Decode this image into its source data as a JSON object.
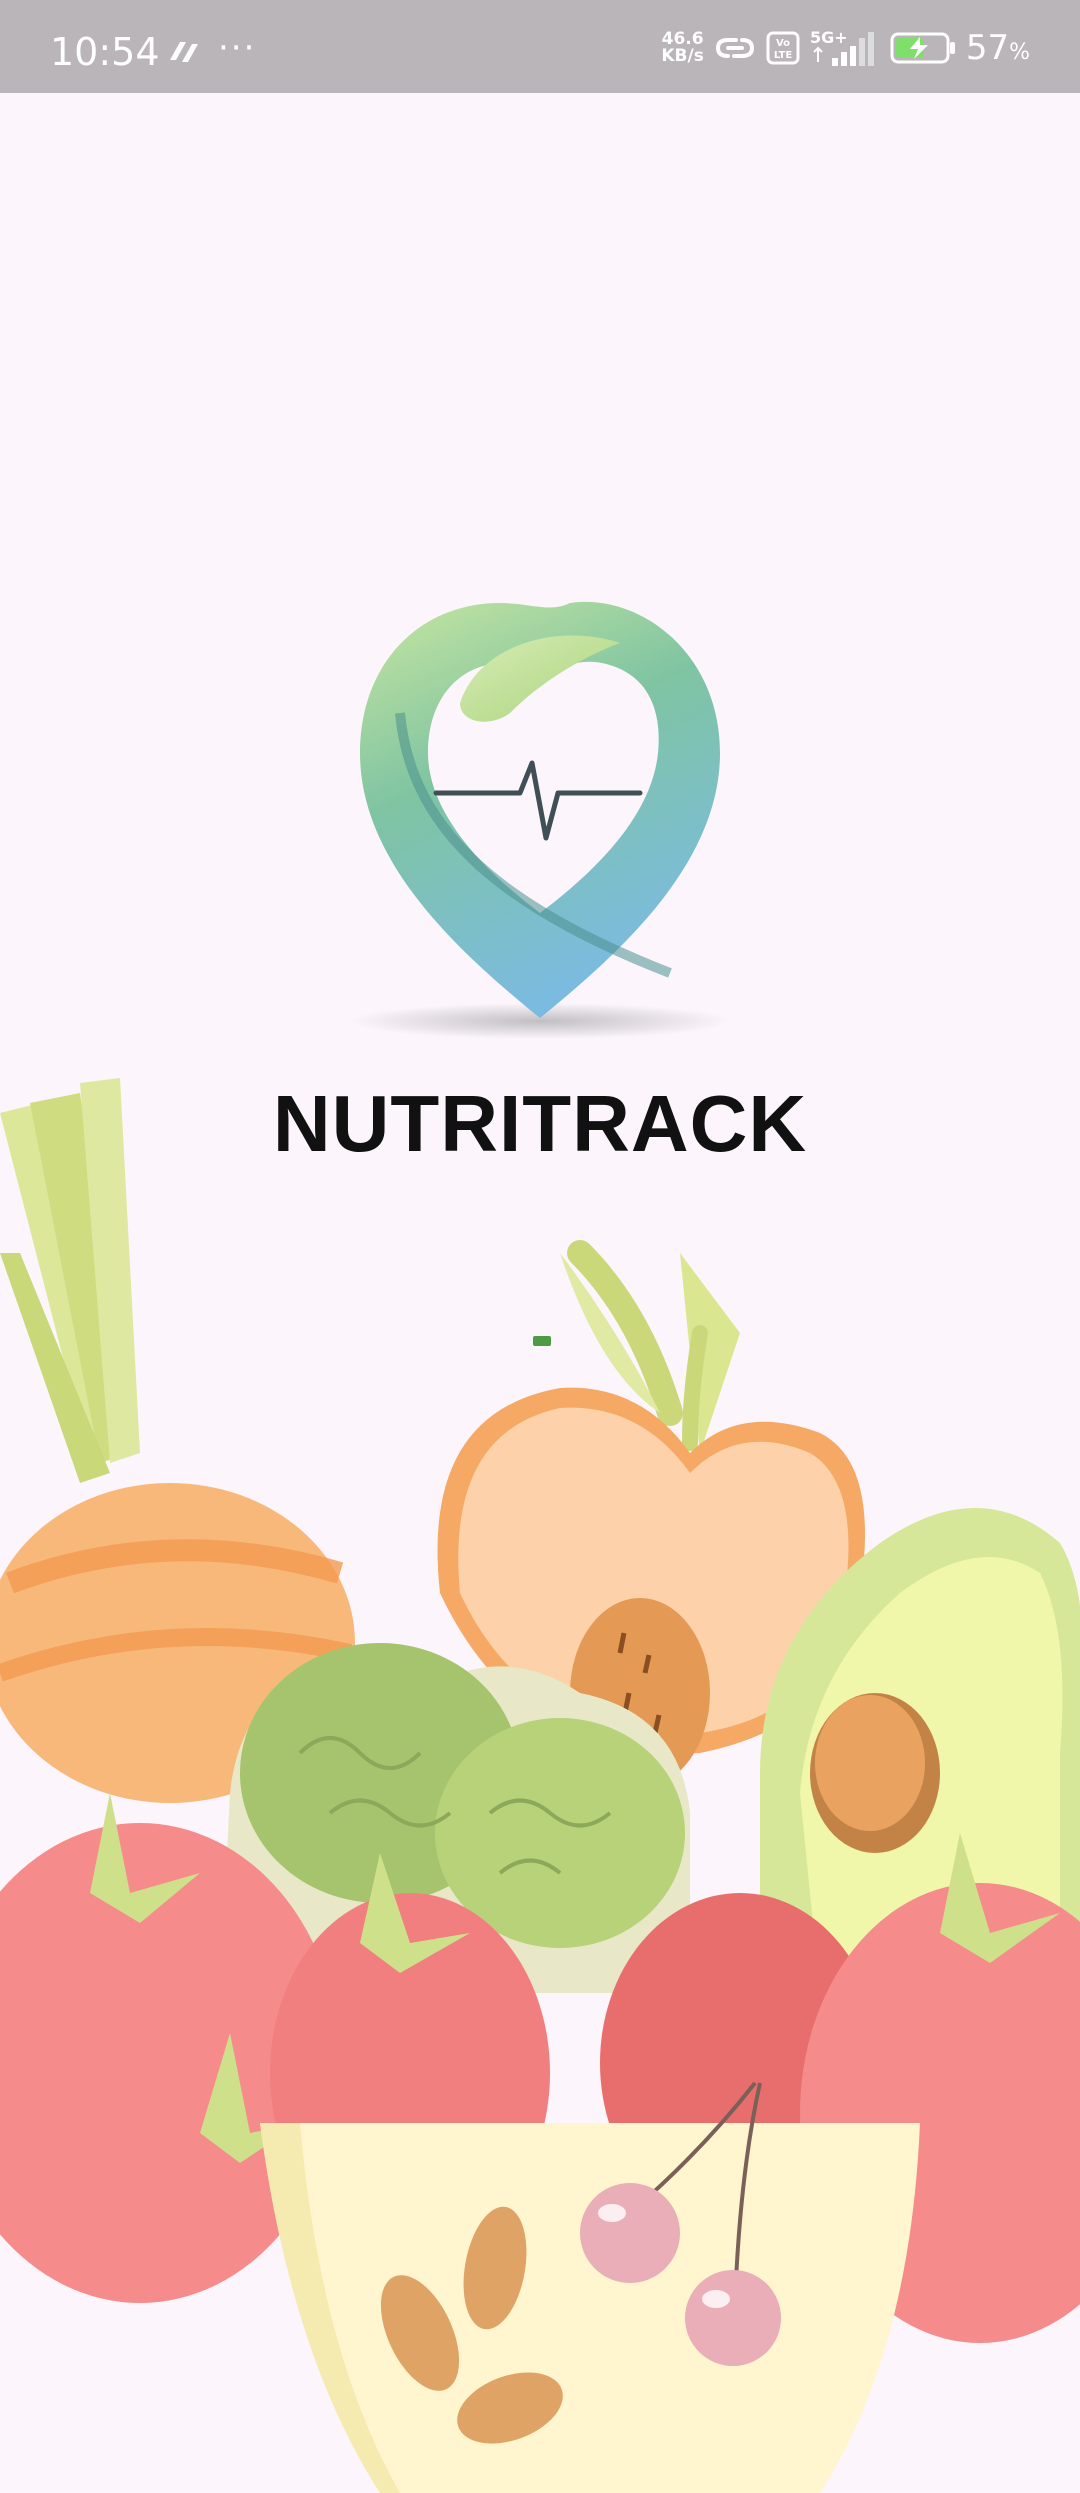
{
  "status_bar": {
    "time": "10:54",
    "more_indicator": "···",
    "net_speed_value": "46.6",
    "net_speed_unit": "KB/s",
    "volte": "Vo LTE",
    "network": "5G+",
    "battery_percent": "57",
    "battery_unit": "%",
    "icons": [
      "app-notification-icon",
      "link-icon",
      "volte-icon",
      "signal-icon",
      "battery-charging-icon"
    ]
  },
  "splash": {
    "brand_name": "NUTRITRACK",
    "logo_icon": "heart-pulse-leaf-icon",
    "loader_color": "#4f9a45",
    "background_color": "#fcf5fc",
    "illustration": "fruits-vegetables-illustration"
  }
}
